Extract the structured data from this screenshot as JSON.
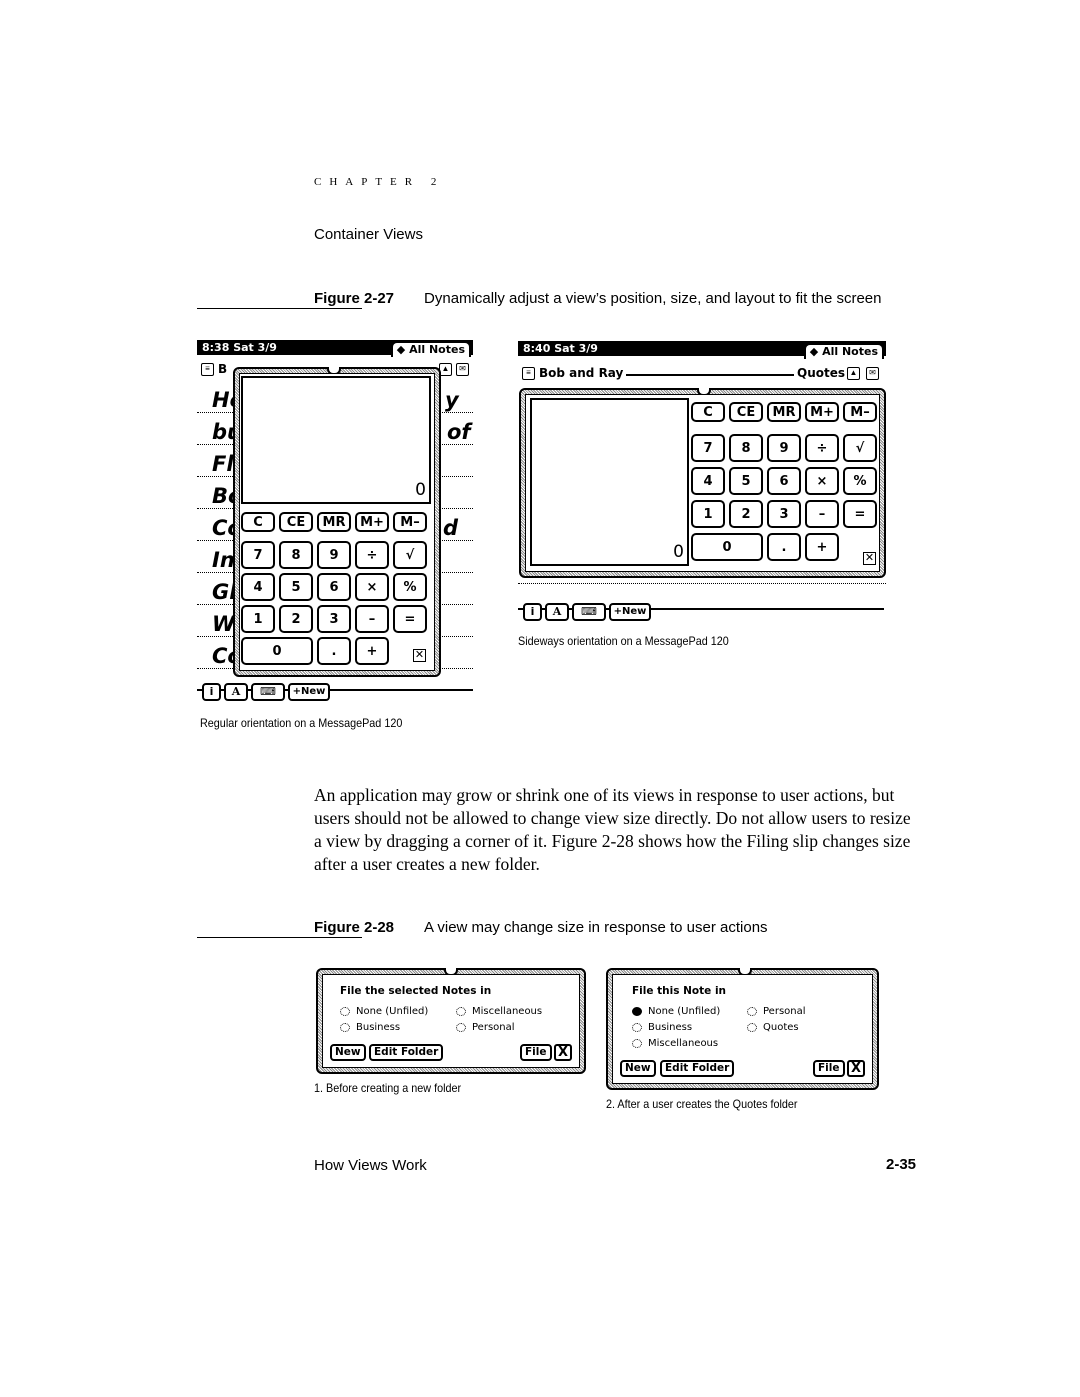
{
  "header": {
    "chapter": "CHAPTER 2",
    "section": "Container Views"
  },
  "figure27": {
    "label": "Figure 2-27",
    "caption": "Dynamically adjust a view’s position, size, and layout to fit the screen",
    "regular": {
      "status_time": "8:38 Sat 3/9",
      "folder_tab": "◆ All Notes",
      "note_title_partial": "B",
      "handwriting_left": [
        "He",
        "bu",
        "Fl",
        "Bo",
        "Co",
        "In",
        "Gl",
        "W",
        "Co"
      ],
      "handwriting_right": [
        "y",
        "of",
        "",
        "",
        "d",
        "",
        "",
        "",
        ""
      ],
      "display_value": "0",
      "keys_row1": [
        "C",
        "CE",
        "MR",
        "M+",
        "M–"
      ],
      "keys_row2": [
        "7",
        "8",
        "9",
        "÷",
        "√"
      ],
      "keys_row3": [
        "4",
        "5",
        "6",
        "×",
        "%"
      ],
      "keys_row4": [
        "1",
        "2",
        "3",
        "–",
        "="
      ],
      "keys_row5": [
        "0",
        ".",
        "+"
      ],
      "close_glyph": "☒",
      "buttonbar": {
        "info": "i",
        "styles": "A",
        "keyboard": "⌨",
        "new": "+New"
      },
      "caption": "Regular orientation on a MessagePad 120"
    },
    "sideways": {
      "status_time": "8:40 Sat 3/9",
      "folder_tab": "◆ All Notes",
      "note_title": "Bob and Ray",
      "folder_name": "Quotes",
      "display_value": "0",
      "keys_row1": [
        "C",
        "CE",
        "MR",
        "M+",
        "M–"
      ],
      "keys_row2": [
        "7",
        "8",
        "9",
        "÷",
        "√"
      ],
      "keys_row3": [
        "4",
        "5",
        "6",
        "×",
        "%"
      ],
      "keys_row4": [
        "1",
        "2",
        "3",
        "–",
        "="
      ],
      "keys_row5": [
        "0",
        ".",
        "+"
      ],
      "close_glyph": "☒",
      "buttonbar": {
        "info": "i",
        "styles": "A",
        "keyboard": "⌨",
        "new": "+New"
      },
      "caption": "Sideways orientation on a MessagePad 120"
    }
  },
  "body": {
    "paragraph": "An application may grow or shrink one of its views in response to user actions, but users should not be allowed to change view size directly. Do not allow users to resize a view by dragging a corner of it. Figure 2-28 shows how the Filing slip changes size after a user creates a new folder."
  },
  "figure28": {
    "label": "Figure 2-28",
    "caption": "A view may change size in response to user actions",
    "before": {
      "title": "File the selected Notes in",
      "options": [
        {
          "label": "None (Unfiled)",
          "selected": false
        },
        {
          "label": "Miscellaneous",
          "selected": false
        },
        {
          "label": "Business",
          "selected": false
        },
        {
          "label": "Personal",
          "selected": false
        }
      ],
      "new_button": "New",
      "edit_folder_button": "Edit Folder",
      "file_button": "File",
      "close_button": "X",
      "caption": "1. Before creating a new folder"
    },
    "after": {
      "title": "File this Note in",
      "options": [
        {
          "label": "None (Unfiled)",
          "selected": true
        },
        {
          "label": "Personal",
          "selected": false
        },
        {
          "label": "Business",
          "selected": false
        },
        {
          "label": "Quotes",
          "selected": false
        },
        {
          "label": "Miscellaneous",
          "selected": false
        }
      ],
      "new_button": "New",
      "edit_folder_button": "Edit Folder",
      "file_button": "File",
      "close_button": "X",
      "caption": "2. After a user creates the Quotes folder"
    }
  },
  "footer": {
    "section": "How Views Work",
    "page_number": "2-35"
  }
}
